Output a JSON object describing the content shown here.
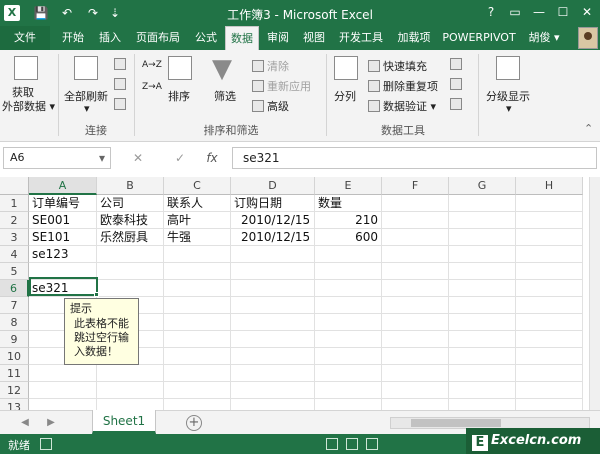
{
  "window": {
    "app_icon": "X",
    "title": "工作簿3 - Microsoft Excel",
    "controls": [
      "?",
      "▭",
      "—",
      "☐",
      "✕"
    ]
  },
  "qat": {
    "save_icon": "💾",
    "undo_icon": "↶",
    "redo_icon": "↷",
    "customize_icon": "⇣"
  },
  "tabs": [
    "文件",
    "开始",
    "插入",
    "页面布局",
    "公式",
    "数据",
    "审阅",
    "视图",
    "开发工具",
    "加载项",
    "POWERPIVOT"
  ],
  "active_tab": "数据",
  "user": "胡俊 ▾",
  "ribbon": {
    "get_external_data_line1": "获取",
    "get_external_data_line2": "外部数据 ▾",
    "refresh_all": "全部刷新",
    "refresh_all_arrow": "▾",
    "group_connections": "连接",
    "sort": "排序",
    "sort_az": "A→Z",
    "sort_za": "Z→A",
    "filter": "筛选",
    "clear": "清除",
    "reapply": "重新应用",
    "advanced": "高级",
    "group_sort_filter": "排序和筛选",
    "text_to_columns": "分列",
    "flash_fill": "快速填充",
    "remove_duplicates": "删除重复项",
    "data_validation": "数据验证 ▾",
    "group_data_tools": "数据工具",
    "outline": "分级显示",
    "outline_arrow": "▾"
  },
  "formula_bar": {
    "name_box": "A6",
    "cancel_icon": "✕",
    "enter_icon": "✓",
    "fx_icon": "fx",
    "value": "se321"
  },
  "columns": [
    "A",
    "B",
    "C",
    "D",
    "E",
    "F",
    "G",
    "H"
  ],
  "rows": [
    "1",
    "2",
    "3",
    "4",
    "5",
    "6",
    "7",
    "8",
    "9",
    "10",
    "11",
    "12",
    "13"
  ],
  "cells": {
    "A1": "订单编号",
    "B1": "公司",
    "C1": "联系人",
    "D1": "订购日期",
    "E1": "数量",
    "A2": "SE001",
    "B2": "欧泰科技",
    "C2": "高叶",
    "D2": "2010/12/15",
    "E2": "210",
    "A3": "SE101",
    "B3": "乐然厨具",
    "C3": "牛强",
    "D3": "2010/12/15",
    "E3": "600",
    "A4": "se123",
    "A6": "se321"
  },
  "tooltip": {
    "title": "提示",
    "body": [
      "此表格不能",
      "跳过空行输",
      "入数据！"
    ]
  },
  "sheets": {
    "active": "Sheet1",
    "add_icon": "+"
  },
  "status": {
    "ready": "就绪"
  },
  "watermark": "Excelcn.com",
  "colors": {
    "accent": "#217346"
  }
}
